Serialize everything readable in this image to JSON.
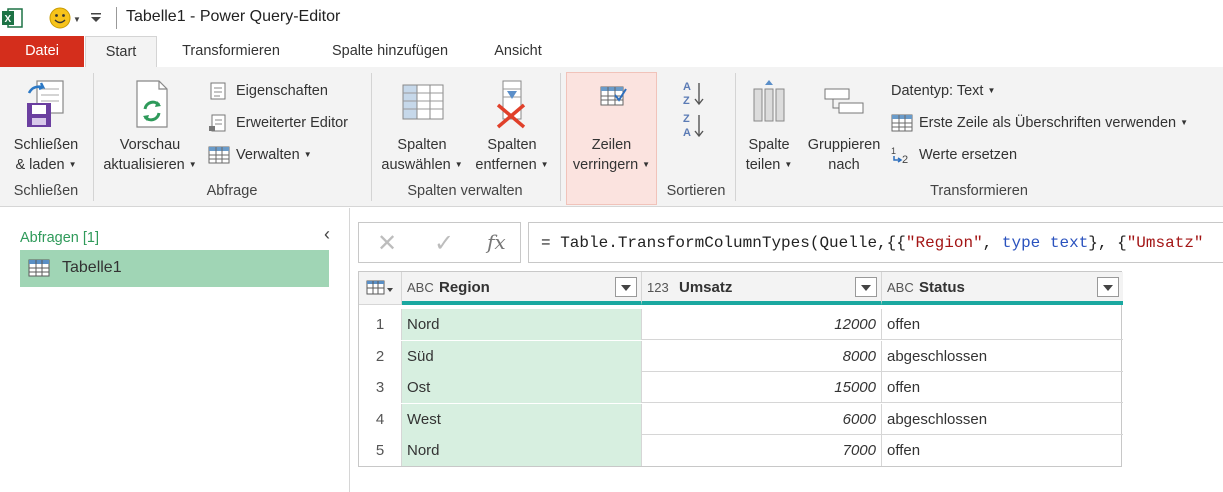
{
  "window": {
    "title": "Tabelle1 - Power Query-Editor"
  },
  "tabs": [
    "Datei",
    "Start",
    "Transformieren",
    "Spalte hinzufügen",
    "Ansicht"
  ],
  "ribbon": {
    "close_load": {
      "line1": "Schließen",
      "line2": "& laden"
    },
    "group_close": "Schließen",
    "preview": {
      "line1": "Vorschau",
      "line2": "aktualisieren"
    },
    "properties": "Eigenschaften",
    "advanced_editor": "Erweiterter Editor",
    "manage": "Verwalten",
    "group_query": "Abfrage",
    "choose_columns": {
      "line1": "Spalten",
      "line2": "auswählen"
    },
    "remove_columns": {
      "line1": "Spalten",
      "line2": "entfernen"
    },
    "group_manage_columns": "Spalten verwalten",
    "reduce_rows": {
      "line1": "Zeilen",
      "line2": "verringern"
    },
    "group_sort": "Sortieren",
    "split_column": {
      "line1": "Spalte",
      "line2": "teilen"
    },
    "group_by": {
      "line1": "Gruppieren",
      "line2": "nach"
    },
    "datatype": "Datentyp: Text",
    "first_row_headers": "Erste Zeile als Überschriften verwenden",
    "replace_values": "Werte ersetzen",
    "group_transform": "Transformieren"
  },
  "queries": {
    "header": "Abfragen [1]",
    "items": [
      {
        "label": "Tabelle1"
      }
    ]
  },
  "formula": {
    "prefix": "= Table.TransformColumnTypes(Quelle,{{",
    "s1": "\"Region\"",
    "sep1": ", ",
    "kw1": "type text",
    "sep2": "}, {",
    "s2": "\"Umsatz\""
  },
  "grid": {
    "columns": [
      {
        "type_icon": "ABC",
        "name": "Region"
      },
      {
        "type_icon": "123",
        "name": "Umsatz"
      },
      {
        "type_icon": "ABC",
        "name": "Status"
      }
    ],
    "rows": [
      {
        "idx": "1",
        "region": "Nord",
        "umsatz": "12000",
        "status": "offen"
      },
      {
        "idx": "2",
        "region": "Süd",
        "umsatz": "8000",
        "status": "abgeschlossen"
      },
      {
        "idx": "3",
        "region": "Ost",
        "umsatz": "15000",
        "status": "offen"
      },
      {
        "idx": "4",
        "region": "West",
        "umsatz": "6000",
        "status": "abgeschlossen"
      },
      {
        "idx": "5",
        "region": "Nord",
        "umsatz": "7000",
        "status": "offen"
      }
    ]
  },
  "colors": {
    "file_tab": "#d42e1c",
    "selected_query": "#a0d5b5",
    "region_column": "#d7efe0",
    "header_accent": "#1aa8a0"
  }
}
